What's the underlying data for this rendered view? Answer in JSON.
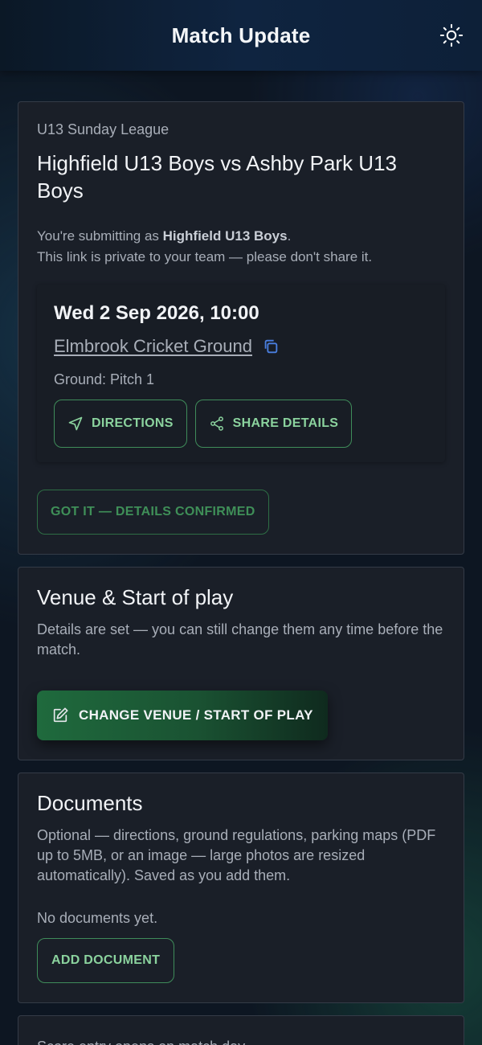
{
  "header": {
    "title": "Match Update",
    "theme_icon": "sun-icon"
  },
  "match": {
    "league": "U13 Sunday League",
    "title": "Highfield U13 Boys vs Ashby Park U13 Boys",
    "submitting_prefix": "You're submitting as ",
    "team": "Highfield U13 Boys",
    "submitting_suffix": ".",
    "privacy_note": "This link is private to your team — please don't share it.",
    "fixture": {
      "datetime": "Wed 2 Sep 2026, 10:00",
      "venue": "Elmbrook Cricket Ground",
      "ground": "Ground: Pitch 1",
      "directions_label": "DIRECTIONS",
      "share_label": "SHARE DETAILS"
    },
    "confirm_label": "GOT IT — DETAILS CONFIRMED"
  },
  "venue_section": {
    "title": "Venue & Start of play",
    "text": "Details are set — you can still change them any time before the match.",
    "change_label": "CHANGE VENUE / START OF PLAY"
  },
  "documents": {
    "title": "Documents",
    "text": "Optional — directions, ground regulations, parking maps (PDF up to 5MB, or an image — large photos are resized automatically). Saved as you add them.",
    "empty": "No documents yet.",
    "add_label": "ADD DOCUMENT"
  },
  "score": {
    "text": "Score entry opens on match day."
  },
  "colors": {
    "accent_green": "#8bd39e",
    "button_green": "#1f6a3d",
    "link_blue": "#4a7fe0"
  }
}
